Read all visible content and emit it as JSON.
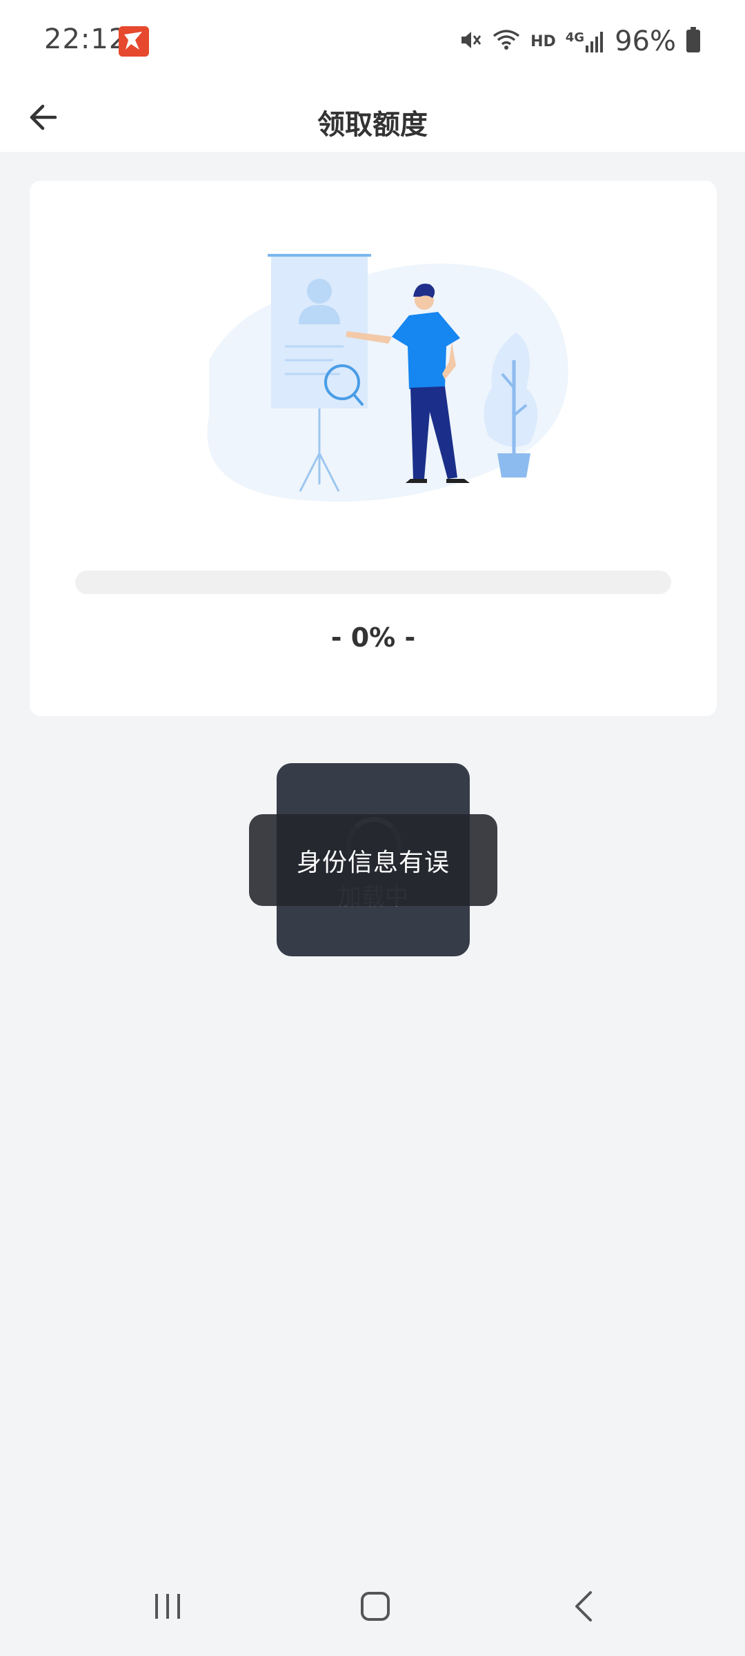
{
  "status_bar": {
    "time": "22:12",
    "network_label": "HD",
    "signal_label": "4G",
    "battery_percent": "96%",
    "icons": [
      "app-notification-icon",
      "mute-icon",
      "wifi-icon",
      "signal-icon",
      "battery-icon"
    ]
  },
  "header": {
    "title": "领取额度",
    "back_icon": "arrow-left-icon"
  },
  "card": {
    "progress_value": 0,
    "progress_text": "- 0% -"
  },
  "loading": {
    "text": "加载中"
  },
  "toast": {
    "text": "身份信息有误"
  },
  "nav_bar": {
    "icons": [
      "recent-apps-icon",
      "home-icon",
      "back-icon"
    ]
  },
  "colors": {
    "accent": "#1a8cff",
    "background": "#f3f4f6",
    "card": "#ffffff",
    "toast": "#24262c",
    "loading_box": "#363d48"
  }
}
